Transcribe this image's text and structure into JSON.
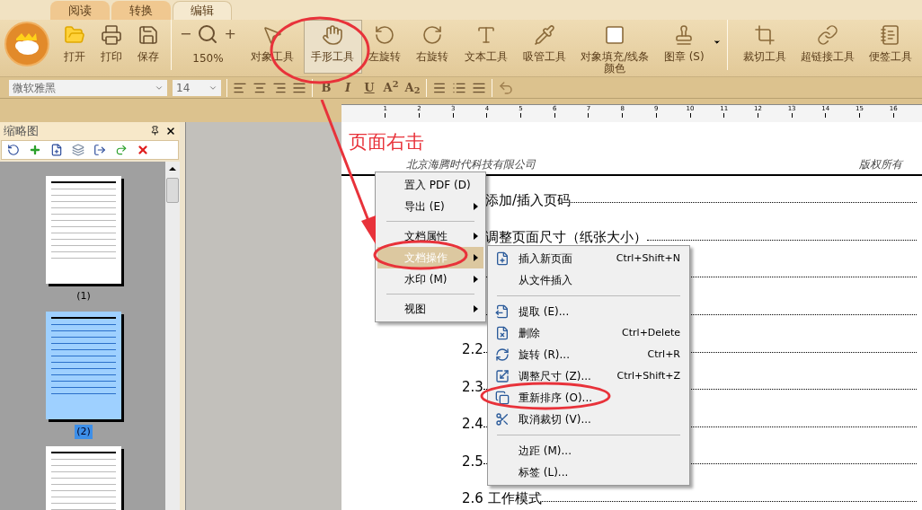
{
  "tabs": [
    {
      "label": "阅读",
      "selected": false
    },
    {
      "label": "转换",
      "selected": false
    },
    {
      "label": "编辑",
      "selected": true
    }
  ],
  "toolbar": {
    "file_tools": [
      {
        "label": "打开"
      },
      {
        "label": "打印"
      },
      {
        "label": "保存"
      }
    ],
    "zoom": {
      "minus": "−",
      "plus": "+",
      "value": "150%"
    },
    "tools": [
      {
        "label": "对象工具",
        "selected": false
      },
      {
        "label": "手形工具",
        "selected": true
      },
      {
        "label": "左旋转",
        "selected": false
      },
      {
        "label": "右旋转",
        "selected": false
      },
      {
        "label": "文本工具",
        "selected": false
      },
      {
        "label": "吸管工具",
        "selected": false
      },
      {
        "label": "对象填充/线条颜色",
        "selected": false
      },
      {
        "label": "图章 (S)",
        "selected": false
      }
    ],
    "extra_tools": [
      {
        "label": "裁切工具"
      },
      {
        "label": "超链接工具"
      },
      {
        "label": "便签工具"
      }
    ]
  },
  "format_bar": {
    "font": "微软雅黑",
    "size": "14",
    "styles": [
      "B",
      "I",
      "U",
      "A$^{2}$",
      "A$_{2}$"
    ]
  },
  "ruler": {
    "numbers": [
      "1",
      "2",
      "3",
      "4",
      "5",
      "6",
      "7",
      "8",
      "9",
      "10",
      "11",
      "12",
      "13",
      "14",
      "15",
      "16"
    ]
  },
  "thumbnail_panel": {
    "title": "缩略图",
    "pages": [
      {
        "label": "(1)",
        "selected": false
      },
      {
        "label": "(2)",
        "selected": true
      },
      {
        "selected": false
      }
    ]
  },
  "page": {
    "header_left": "北京海腾时代科技有限公司",
    "header_right": "版权所有",
    "toc": [
      "添加/插入页码",
      "调整页面尺寸（纸张大小）",
      "2.2",
      "2.3",
      "2.4",
      "2.5",
      "2.6 工作模式"
    ]
  },
  "context_menu": [
    {
      "kind": "item",
      "label": "置入 PDF (D)",
      "submenu": false,
      "highlighted": false
    },
    {
      "kind": "item",
      "label": "导出 (E)",
      "submenu": true,
      "highlighted": false
    },
    {
      "kind": "separator"
    },
    {
      "kind": "item",
      "label": "文档属性",
      "submenu": true,
      "highlighted": false
    },
    {
      "kind": "item",
      "label": "文档操作",
      "submenu": true,
      "highlighted": true
    },
    {
      "kind": "item",
      "label": "水印 (M)",
      "submenu": true,
      "highlighted": false
    },
    {
      "kind": "separator"
    },
    {
      "kind": "item",
      "label": "视图",
      "submenu": true,
      "highlighted": false
    }
  ],
  "submenu": [
    {
      "kind": "item",
      "label": "插入新页面",
      "shortcut": "Ctrl+Shift+N"
    },
    {
      "kind": "item",
      "label": "从文件插入"
    },
    {
      "kind": "separator"
    },
    {
      "kind": "item",
      "label": "提取 (E)..."
    },
    {
      "kind": "item",
      "label": "删除",
      "shortcut": "Ctrl+Delete"
    },
    {
      "kind": "item",
      "label": "旋转 (R)...",
      "shortcut": "Ctrl+R"
    },
    {
      "kind": "item",
      "label": "调整尺寸 (Z)...",
      "shortcut": "Ctrl+Shift+Z"
    },
    {
      "kind": "item",
      "label": "重新排序 (O)..."
    },
    {
      "kind": "item",
      "label": "取消裁切 (V)..."
    },
    {
      "kind": "separator"
    },
    {
      "kind": "item",
      "label": "边距 (M)..."
    },
    {
      "kind": "item",
      "label": "标签 (L)..."
    }
  ],
  "annotation": {
    "text": "页面右击"
  }
}
